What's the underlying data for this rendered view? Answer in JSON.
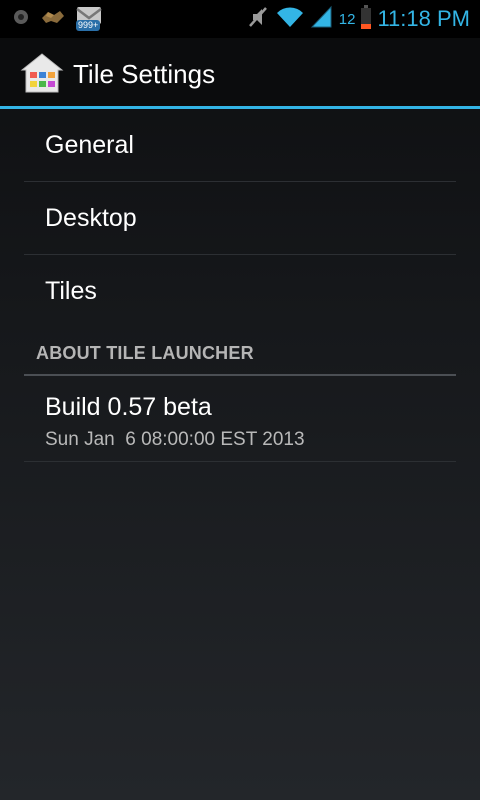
{
  "status_bar": {
    "mail_badge": "999+",
    "battery_level": "12",
    "time": "11:18 PM",
    "icons": [
      "record-icon",
      "handshake-icon",
      "gmail-icon",
      "mute-icon",
      "wifi-icon",
      "signal-icon",
      "battery-icon"
    ]
  },
  "action_bar": {
    "title": "Tile Settings",
    "icon": "tile-launcher-home-icon"
  },
  "preferences": {
    "items": [
      {
        "label": "General"
      },
      {
        "label": "Desktop"
      },
      {
        "label": "Tiles"
      }
    ],
    "about_category": "ABOUT TILE LAUNCHER",
    "about": {
      "title": "Build 0.57 beta",
      "summary": "Sun Jan  6 08:00:00 EST 2013"
    }
  },
  "colors": {
    "accent": "#33b5e5",
    "background": "#16181b",
    "divider": "#2c2f33"
  }
}
